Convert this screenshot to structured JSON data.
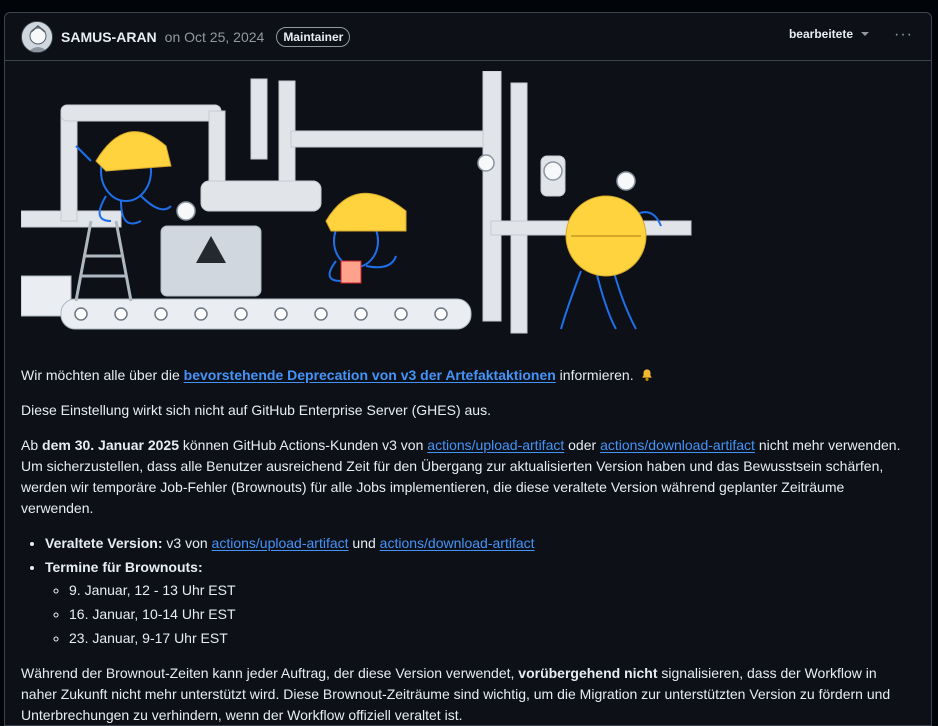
{
  "header": {
    "author": "SAMUS-ARAN",
    "date": "on Oct 25, 2024",
    "badge": "Maintainer",
    "edited_label": "bearbeitete",
    "more_glyph": "···"
  },
  "post": {
    "p1_before": "Wir möchten alle über die ",
    "p1_link": "bevorstehende Deprecation von v3 der Artefaktaktionen",
    "p1_after": " informieren. ",
    "p2": "Diese Einstellung wirkt sich nicht auf GitHub Enterprise Server (GHES) aus.",
    "p3_a": "Ab ",
    "p3_bold": "dem 30. Januar 2025",
    "p3_b": " können GitHub Actions-Kunden v3 von ",
    "link_upload": "actions/upload-artifact",
    "p3_c": " oder ",
    "link_download": "actions/download-artifact",
    "p3_d": " nicht mehr verwenden. Um sicherzustellen, dass alle Benutzer ausreichend Zeit für den Übergang zur aktualisierten Version haben und das Bewusstsein schärfen, werden wir temporäre Job-Fehler (Brownouts) für alle Jobs implementieren, die diese veraltete Version während geplanter Zeiträume verwenden.",
    "li1_bold": "Veraltete Version:",
    "li1_a": " v3 von ",
    "li1_b": " und ",
    "li2_bold": "Termine für Brownouts:",
    "brownouts": [
      "9. Januar, 12 - 13 Uhr EST",
      "16. Januar, 10-14 Uhr EST",
      "23. Januar, 9-17 Uhr EST"
    ],
    "p4_a": "Während der Brownout-Zeiten kann jeder Auftrag, der diese Version verwendet, ",
    "p4_bold": "vorübergehend nicht",
    "p4_b": " signalisieren, dass der Workflow in naher Zukunft nicht mehr unterstützt wird. Diese Brownout-Zeiträume sind wichtig, um die Migration zur unterstützten Version zu fördern und Unterbrechungen zu verhindern, wenn der Workflow offiziell veraltet ist."
  },
  "icons": {
    "avatar": "avatar",
    "caret": "chevron-down-icon",
    "more": "kebab-horizontal-icon",
    "bell": "bell-icon",
    "illustration": "octocat-construction-illustration"
  },
  "colors": {
    "background": "#0d1117",
    "link": "#4493f8",
    "text": "#e6edf3",
    "muted": "#9198a1",
    "hardhat": "#ffd33d",
    "octocat_stroke": "#1f6feb"
  }
}
